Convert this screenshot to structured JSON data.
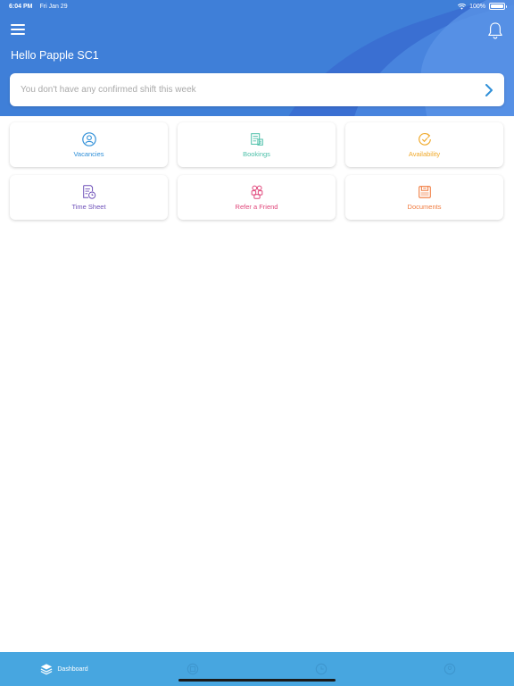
{
  "status_bar": {
    "time": "6:04 PM",
    "date": "Fri Jan 29",
    "battery": "100%"
  },
  "header": {
    "greeting": "Hello Papple SC1"
  },
  "shift_card": {
    "text": "You don't have any confirmed shift this week"
  },
  "tiles": [
    {
      "label": "Vacancies",
      "icon": "user-circle-icon",
      "color": "#2f8fd8"
    },
    {
      "label": "Bookings",
      "icon": "calendar-grid-icon",
      "color": "#4bbfa8"
    },
    {
      "label": "Availability",
      "icon": "clock-check-icon",
      "color": "#f0a92a"
    },
    {
      "label": "Time Sheet",
      "icon": "timesheet-icon",
      "color": "#6d4fb8"
    },
    {
      "label": "Refer a Friend",
      "icon": "people-icon",
      "color": "#e0467a"
    },
    {
      "label": "Documents",
      "icon": "folder-icon",
      "color": "#f07b3f"
    }
  ],
  "tabbar": {
    "items": [
      {
        "label": "Dashboard",
        "icon": "layers-icon",
        "active": true
      },
      {
        "label": "",
        "icon": "calendar-icon",
        "active": false
      },
      {
        "label": "",
        "icon": "clock-icon",
        "active": false
      },
      {
        "label": "",
        "icon": "user-icon",
        "active": false
      }
    ]
  },
  "colors": {
    "header": "#3f7fd8",
    "tabbar": "#47a6e0",
    "chevron": "#2f8fd8"
  }
}
